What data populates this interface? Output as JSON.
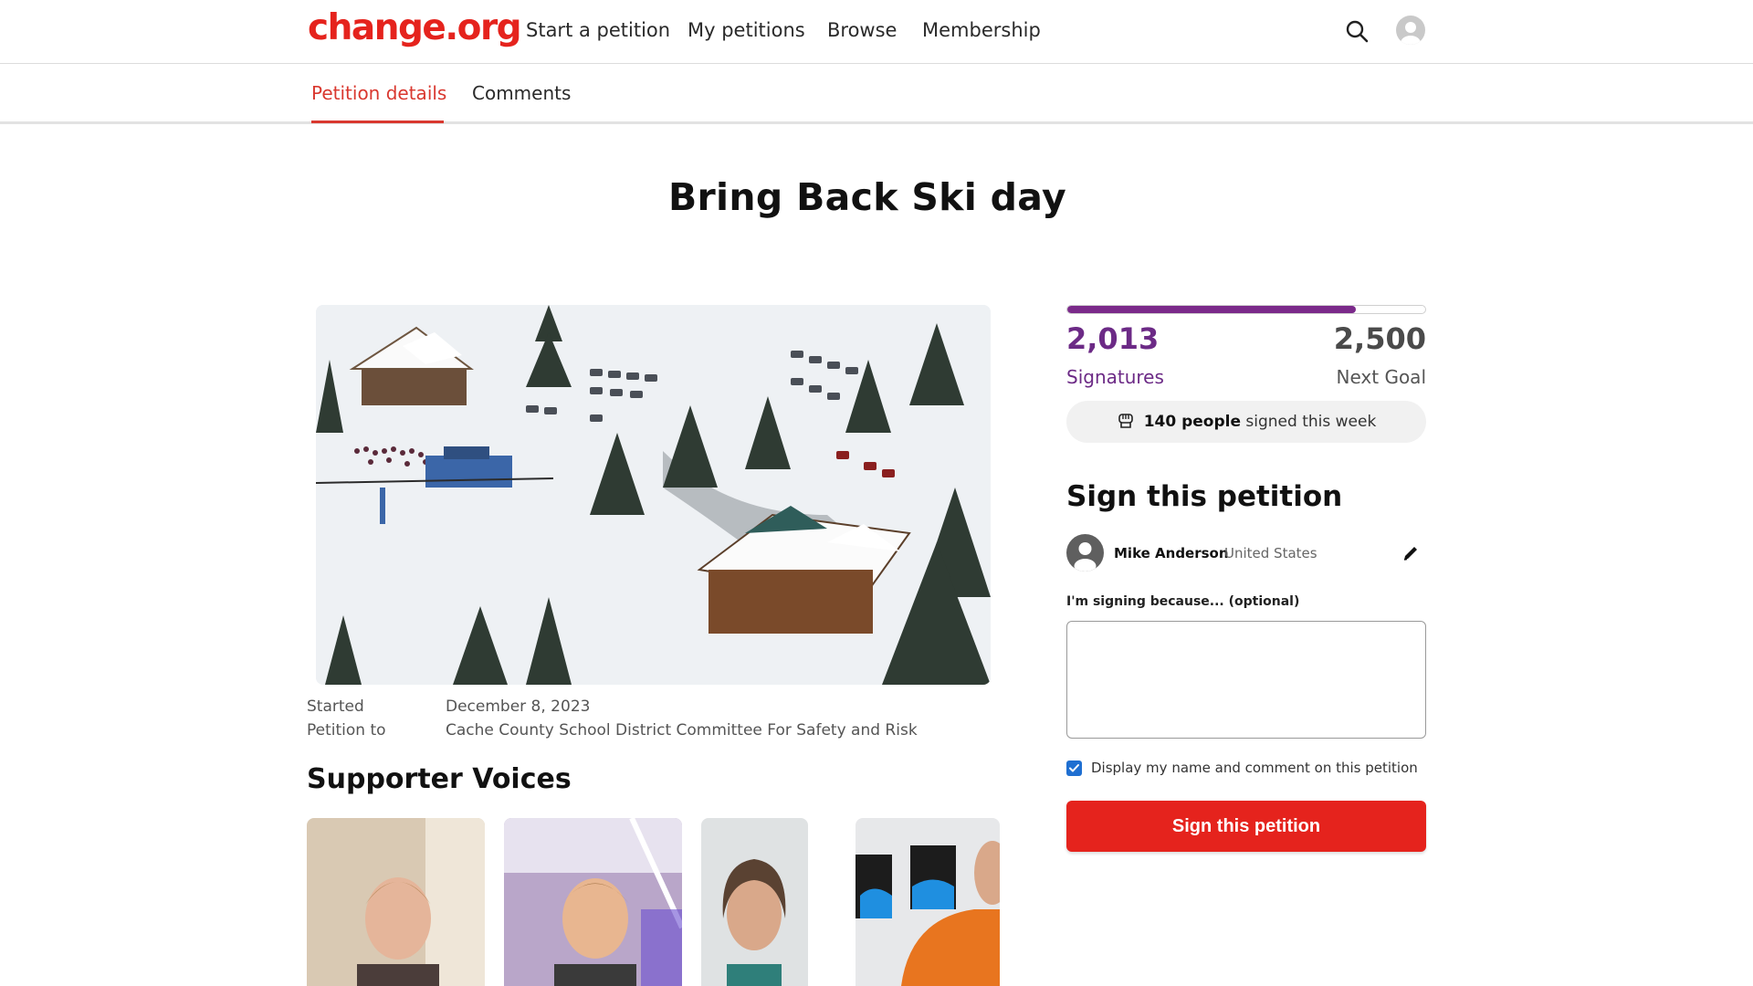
{
  "brand": {
    "logo_text": "change.org",
    "color": "#e5231d"
  },
  "nav": {
    "links": [
      "Start a petition",
      "My petitions",
      "Browse",
      "Membership"
    ],
    "search_icon": "search-icon",
    "avatar_icon": "user-avatar-icon"
  },
  "tabs": {
    "items": [
      "Petition details",
      "Comments"
    ],
    "active": "Petition details"
  },
  "petition": {
    "title": "Bring Back Ski day",
    "started_label": "Started",
    "started_value": "December 8, 2023",
    "petition_to_label": "Petition to",
    "petition_to_value": "Cache County School District Committee For Safety and Risk"
  },
  "supporter_voices": {
    "heading": "Supporter Voices",
    "count": 4
  },
  "progress": {
    "signatures": "2,013",
    "signatures_label": "Signatures",
    "goal": "2,500",
    "goal_label": "Next Goal",
    "fraction": 0.8052,
    "fill_color": "#7b2a8a"
  },
  "weekly": {
    "icon": "raised-fist-icon",
    "count_text": "140 people",
    "suffix_text": "signed this week"
  },
  "sign_form": {
    "heading": "Sign this petition",
    "user_name": "Mike Anderson",
    "user_country": "United States",
    "reason_label": "I'm signing because... (optional)",
    "reason_value": "",
    "display_checkbox_label": "Display my name and comment on this petition",
    "display_checked": true,
    "submit_label": "Sign this petition",
    "submit_color": "#e5231d"
  }
}
